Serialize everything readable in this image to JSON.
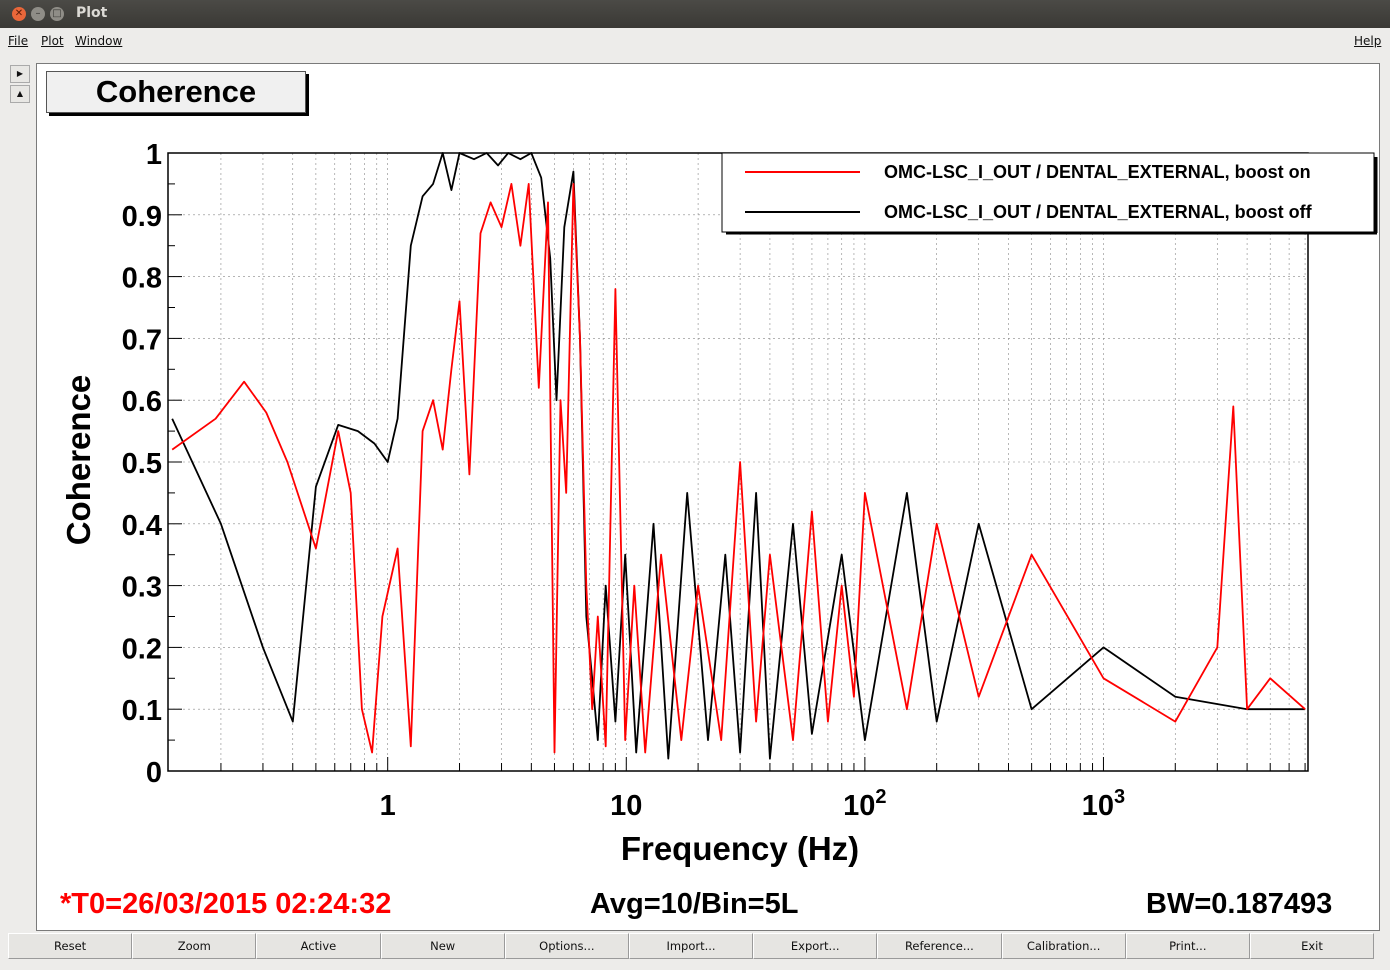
{
  "window": {
    "title": "Plot"
  },
  "menubar": {
    "file": "File",
    "plot": "Plot",
    "window": "Window",
    "help": "Help"
  },
  "plot_title": "Coherence",
  "info": {
    "t0": "*T0=26/03/2015 02:24:32",
    "avg": "Avg=10/Bin=5L",
    "bw": "BW=0.187493",
    "t0_color": "#ff0000"
  },
  "buttons": [
    "Reset",
    "Zoom",
    "Active",
    "New",
    "Options...",
    "Import...",
    "Export...",
    "Reference...",
    "Calibration...",
    "Print...",
    "Exit"
  ],
  "chart_data": {
    "type": "line",
    "title": "Coherence",
    "xlabel": "Frequency (Hz)",
    "ylabel": "Coherence",
    "xscale": "log",
    "xlim": [
      0.12,
      7200
    ],
    "ylim": [
      0,
      1
    ],
    "xticks": [
      "1",
      "10",
      "10^2",
      "10^3"
    ],
    "yticks": [
      "0",
      "0.1",
      "0.2",
      "0.3",
      "0.4",
      "0.5",
      "0.6",
      "0.7",
      "0.8",
      "0.9",
      "1"
    ],
    "grid": true,
    "legend_position": "top-right",
    "series": [
      {
        "name": "OMC-LSC_I_OUT / DENTAL_EXTERNAL, boost on",
        "color": "#ff0000",
        "x": [
          0.125,
          0.19,
          0.25,
          0.31,
          0.38,
          0.5,
          0.62,
          0.7,
          0.78,
          0.86,
          0.95,
          1.1,
          1.25,
          1.4,
          1.55,
          1.7,
          1.85,
          2.0,
          2.2,
          2.45,
          2.7,
          3.0,
          3.3,
          3.6,
          3.9,
          4.3,
          4.7,
          5.0,
          5.3,
          5.6,
          6.0,
          6.4,
          6.8,
          7.2,
          7.6,
          8.2,
          9.0,
          9.9,
          10.8,
          12,
          14,
          17,
          20,
          25,
          30,
          35,
          40,
          50,
          60,
          70,
          80,
          90,
          100,
          150,
          200,
          300,
          500,
          1000,
          2000,
          3000,
          3500,
          4000,
          5000,
          7000
        ],
        "y": [
          0.52,
          0.57,
          0.63,
          0.58,
          0.5,
          0.36,
          0.55,
          0.45,
          0.1,
          0.03,
          0.25,
          0.36,
          0.04,
          0.55,
          0.6,
          0.52,
          0.65,
          0.76,
          0.48,
          0.87,
          0.92,
          0.88,
          0.95,
          0.85,
          0.95,
          0.62,
          0.92,
          0.03,
          0.6,
          0.45,
          0.95,
          0.7,
          0.3,
          0.1,
          0.25,
          0.04,
          0.78,
          0.05,
          0.3,
          0.03,
          0.35,
          0.05,
          0.3,
          0.05,
          0.5,
          0.08,
          0.35,
          0.05,
          0.42,
          0.08,
          0.3,
          0.12,
          0.45,
          0.1,
          0.4,
          0.12,
          0.35,
          0.15,
          0.08,
          0.2,
          0.59,
          0.1,
          0.15,
          0.1
        ]
      },
      {
        "name": "OMC-LSC_I_OUT / DENTAL_EXTERNAL, boost off",
        "color": "#000000",
        "x": [
          0.125,
          0.2,
          0.3,
          0.4,
          0.5,
          0.62,
          0.75,
          0.88,
          1.0,
          1.1,
          1.25,
          1.4,
          1.55,
          1.7,
          1.85,
          2.0,
          2.3,
          2.6,
          2.9,
          3.2,
          3.6,
          4.0,
          4.4,
          4.8,
          5.1,
          5.5,
          6.0,
          6.4,
          6.8,
          7.2,
          7.6,
          8.2,
          9.0,
          9.9,
          11,
          13,
          15,
          18,
          22,
          26,
          30,
          35,
          40,
          50,
          60,
          80,
          100,
          150,
          200,
          300,
          500,
          1000,
          2000,
          4000,
          7000
        ],
        "y": [
          0.57,
          0.4,
          0.2,
          0.08,
          0.46,
          0.56,
          0.55,
          0.53,
          0.5,
          0.57,
          0.85,
          0.93,
          0.95,
          1.0,
          0.94,
          1.0,
          0.99,
          1.0,
          0.98,
          1.0,
          0.99,
          1.0,
          0.96,
          0.83,
          0.6,
          0.88,
          0.97,
          0.7,
          0.25,
          0.15,
          0.05,
          0.3,
          0.08,
          0.35,
          0.03,
          0.4,
          0.02,
          0.45,
          0.05,
          0.35,
          0.03,
          0.45,
          0.02,
          0.4,
          0.06,
          0.35,
          0.05,
          0.45,
          0.08,
          0.4,
          0.1,
          0.2,
          0.12,
          0.1,
          0.1
        ]
      }
    ]
  }
}
